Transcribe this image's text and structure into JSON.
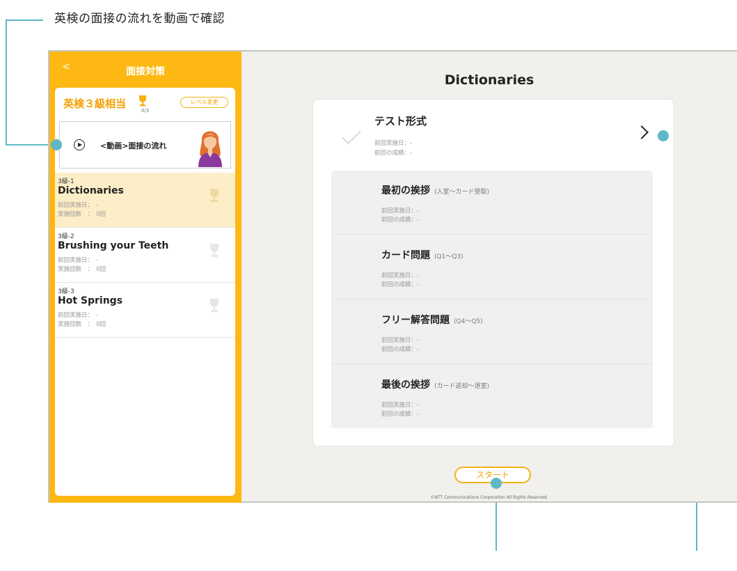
{
  "annotation": {
    "caption": "英検の面接の流れを動画で確認"
  },
  "sidebar": {
    "back": "<",
    "title": "面接対策",
    "level": "英検３級相当",
    "trophy_count": "0/3",
    "level_button": "レベル変更",
    "video_label": "<動画>面接の流れ",
    "lessons": [
      {
        "code": "3級-1",
        "name": "Dictionaries",
        "last_date": "前回実施日：　-",
        "count": "実施回数　：　0回"
      },
      {
        "code": "3級-2",
        "name": "Brushing your Teeth",
        "last_date": "前回実施日：　-",
        "count": "実施回数　：　0回"
      },
      {
        "code": "3級-3",
        "name": "Hot Springs",
        "last_date": "前回実施日：　-",
        "count": "実施回数　：　0回"
      }
    ]
  },
  "main": {
    "title": "Dictionaries",
    "test": {
      "title": "テスト形式",
      "last_date": "前回実施日：-",
      "last_result": "前回の成績：-"
    },
    "sections": [
      {
        "title": "最初の挨拶",
        "sub": "(入室〜カード受取)",
        "last_date": "前回実施日：-",
        "last_result": "前回の成績：-"
      },
      {
        "title": "カード問題",
        "sub": "(Q1〜Q3)",
        "last_date": "前回実施日：-",
        "last_result": "前回の成績：-"
      },
      {
        "title": "フリー解答問題",
        "sub": "(Q4〜Q5)",
        "last_date": "前回実施日：-",
        "last_result": "前回の成績：-"
      },
      {
        "title": "最後の挨拶",
        "sub": "(カード返却〜退室)",
        "last_date": "前回実施日：-",
        "last_result": "前回の成績：-"
      }
    ],
    "start_button": "スタート",
    "copyright": "©NTT Communications Corporation All Rights Reserved."
  },
  "colors": {
    "brand": "#fdb813",
    "accent": "#f5a000",
    "callout": "#5fb7c5",
    "selected": "#fdeec8"
  },
  "icons": [
    "back-icon",
    "trophy-icon",
    "play-icon",
    "check-icon",
    "chevron-right-icon"
  ]
}
